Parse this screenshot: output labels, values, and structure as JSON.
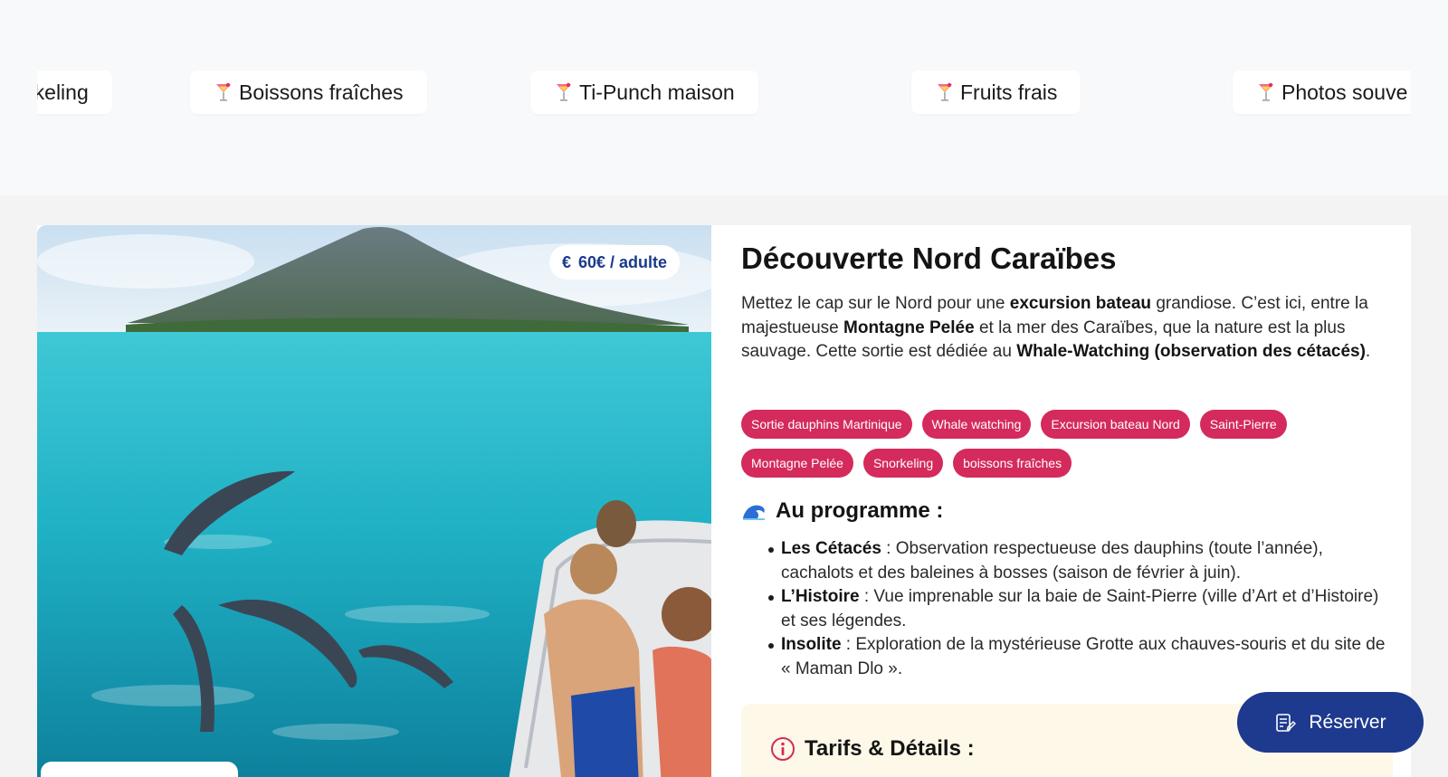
{
  "marquee": {
    "chips": [
      {
        "label": "rkeling",
        "icon": "cocktail-icon"
      },
      {
        "label": "Boissons fraîches",
        "icon": "cocktail-icon"
      },
      {
        "label": "Ti-Punch maison",
        "icon": "cocktail-icon"
      },
      {
        "label": "Fruits frais",
        "icon": "cocktail-icon"
      },
      {
        "label": "Photos souve",
        "icon": "cocktail-icon"
      }
    ]
  },
  "excursion": {
    "price_label": "60€ / adulte",
    "price_icon": "euro-icon",
    "title": "Découverte Nord Caraïbes",
    "description": {
      "p1": "Mettez le cap sur le Nord pour une ",
      "b1": "excursion bateau",
      "p2": " grandiose. C’est ici, entre la majestueuse ",
      "b2": "Montagne Pelée",
      "p3": " et la mer des Caraïbes, que la nature est la plus sauvage. Cette sortie est dédiée au ",
      "b3": "Whale-Watching (observation des cétacés)",
      "p4": "."
    },
    "tags": [
      "Sortie dauphins Martinique",
      "Whale watching",
      "Excursion bateau Nord",
      "Saint-Pierre",
      "Montagne Pelée",
      "Snorkeling",
      "boissons fraîches"
    ],
    "program": {
      "title": "Au programme :",
      "icon": "wave-icon",
      "items": [
        {
          "bold": "Les Cétacés",
          "text": " : Observation respectueuse des dauphins (toute l’année), cachalots et des baleines à bosses (saison de février à juin)."
        },
        {
          "bold": "L’Histoire",
          "text": " : Vue imprenable sur la baie de Saint-Pierre (ville d’Art et d’Histoire) et ses légendes."
        },
        {
          "bold": "Insolite",
          "text": " : Exploration de la mystérieuse Grotte aux chauves-souris et du site de « Maman Dlo »."
        }
      ]
    },
    "tarifs": {
      "title": "Tarifs & Détails :",
      "icon": "info-icon"
    }
  },
  "reserve_button": {
    "label": "Réserver",
    "icon": "booking-icon"
  },
  "colors": {
    "accent": "#1d3a8f",
    "tag": "#d42a5c",
    "tarifs_bg": "#fdf8e8"
  }
}
